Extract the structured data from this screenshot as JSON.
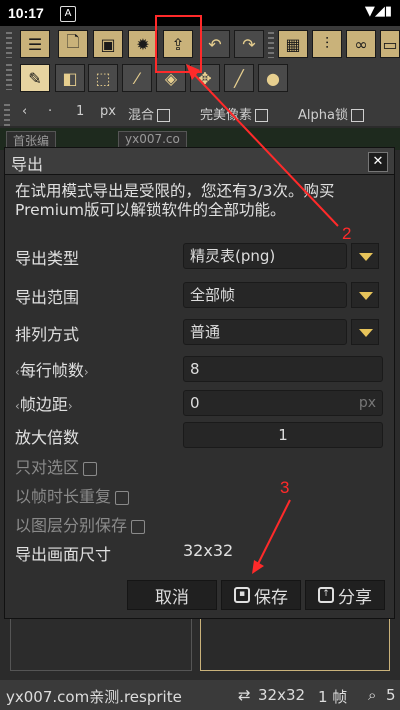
{
  "status_bar": {
    "time": "10:17",
    "badge_icon": "A",
    "right_icons": "▼◢▮"
  },
  "toolbar": {
    "row3_items": [
      "‹",
      "·",
      "1",
      "px",
      "混合",
      "完美像素",
      "Alpha锁"
    ],
    "tabs": [
      "首张编",
      "yx007.co"
    ]
  },
  "dialog": {
    "title": "导出",
    "close_glyph": "✕",
    "message": "在试用模式导出是受限的，您还有3/3次。购买Premium版可以解锁软件的全部功能。",
    "fields": {
      "export_type": {
        "label": "导出类型",
        "value": "精灵表(png)"
      },
      "export_range": {
        "label": "导出范围",
        "value": "全部帧"
      },
      "arrangement": {
        "label": "排列方式",
        "value": "普通"
      },
      "frames_per_row": {
        "label": "每行帧数",
        "value": "8"
      },
      "frame_margin": {
        "label": "帧边距",
        "value": "0",
        "unit": "px"
      },
      "scale": {
        "label": "放大倍数",
        "value": "1"
      }
    },
    "options": {
      "only_selection": "只对选区",
      "repeat_by_duration": "以帧时长重复",
      "save_layers_separately": "以图层分别保存"
    },
    "size": {
      "label": "导出画面尺寸",
      "value": "32x32"
    },
    "buttons": {
      "cancel": "取消",
      "save": "保存",
      "share": "分享"
    }
  },
  "bottom_bar": {
    "text": "yx007.com亲测.resprite",
    "size": "32x32",
    "frames": "1 帧",
    "zoom": "5"
  },
  "annotations": {
    "step2": "2",
    "step3": "3",
    "color": "#ff2a2a"
  }
}
